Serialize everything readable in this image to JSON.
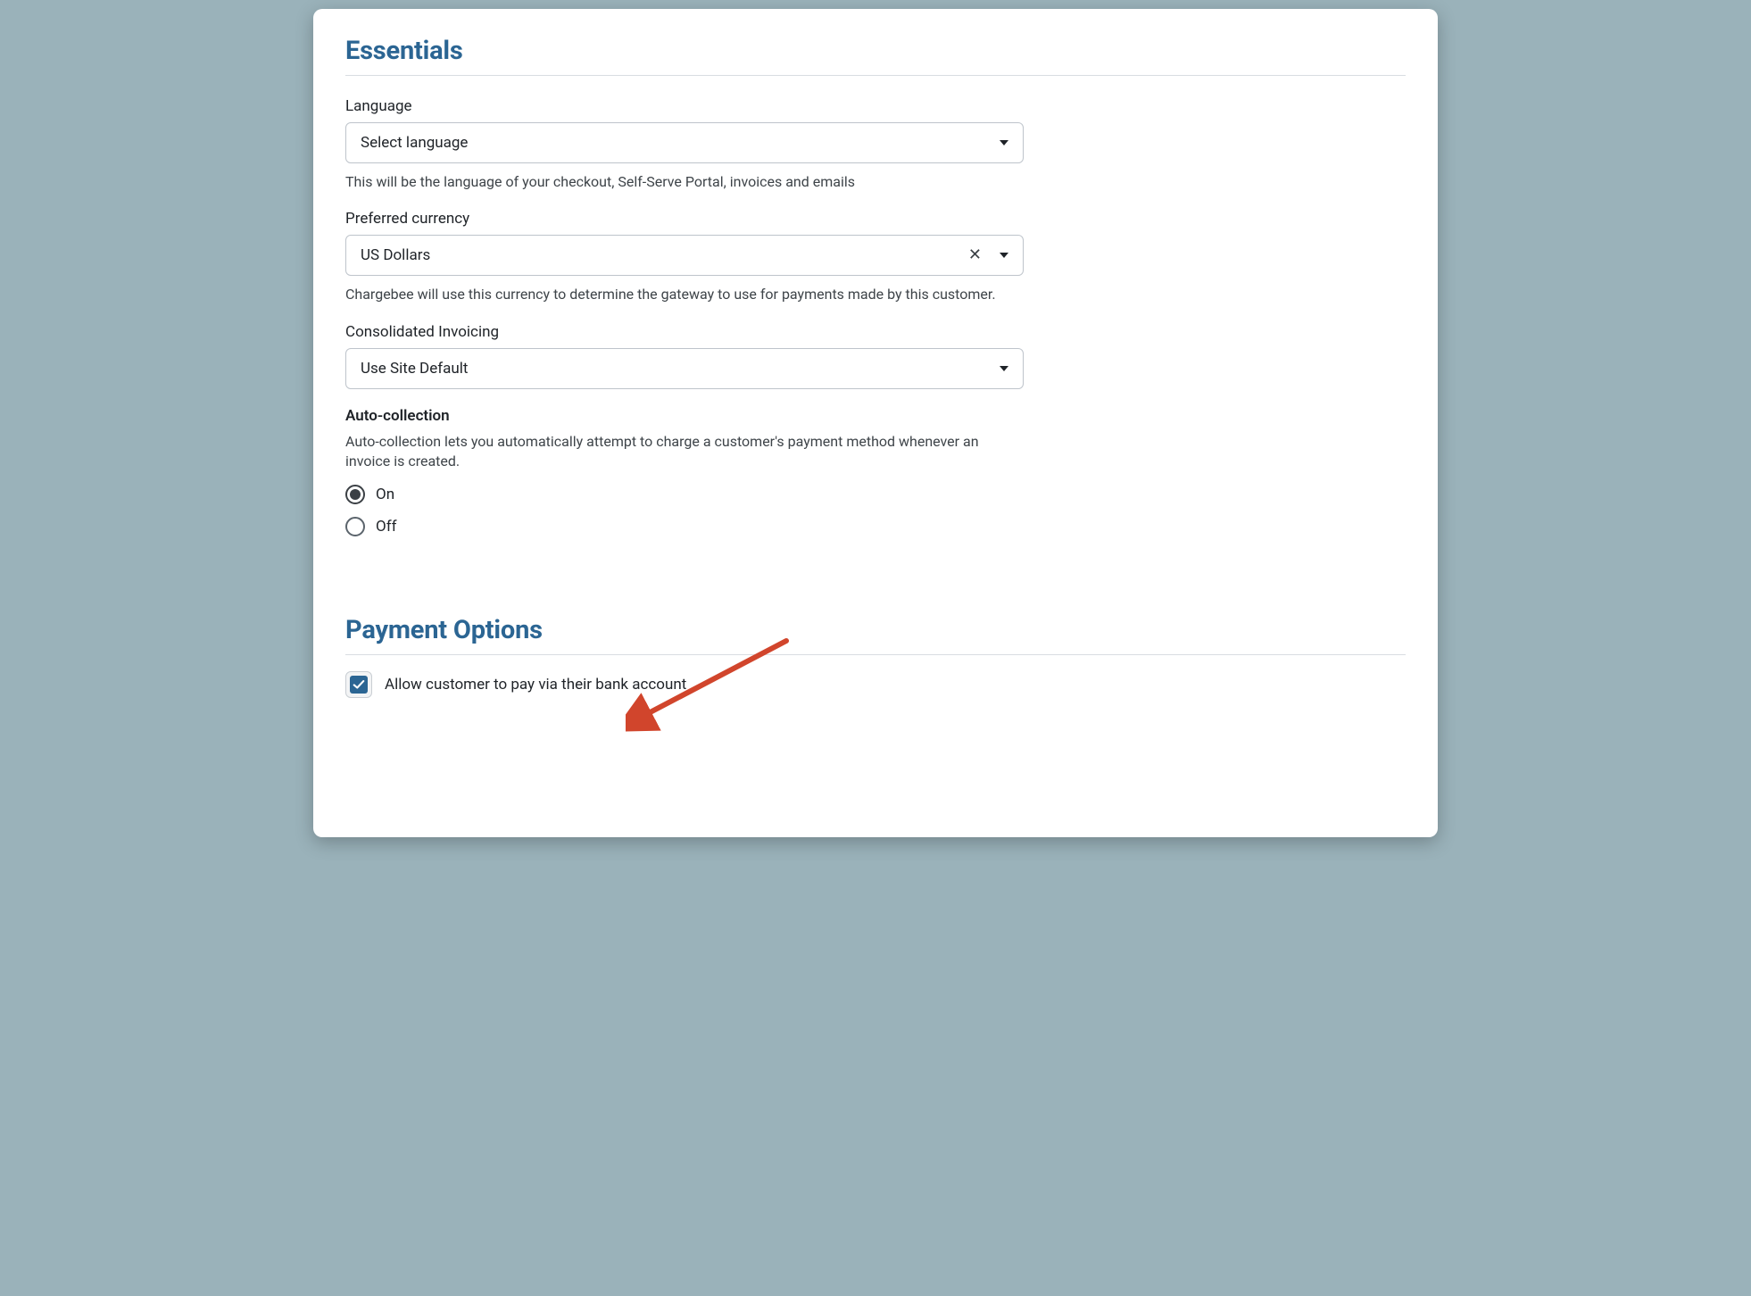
{
  "sections": {
    "essentials": {
      "title": "Essentials",
      "language": {
        "label": "Language",
        "value": "Select language",
        "help": "This will be the language of your checkout, Self-Serve Portal, invoices and emails"
      },
      "currency": {
        "label": "Preferred currency",
        "value": "US Dollars",
        "help": "Chargebee will use this currency to determine the gateway to use for payments made by this customer."
      },
      "consolidated": {
        "label": "Consolidated Invoicing",
        "value": "Use Site Default"
      },
      "auto_collection": {
        "label": "Auto-collection",
        "help": "Auto-collection lets you automatically attempt to charge a customer's payment method whenever an invoice is created.",
        "options": {
          "on": "On",
          "off": "Off"
        },
        "selected": "on"
      }
    },
    "payment_options": {
      "title": "Payment Options",
      "bank_checkbox": {
        "label": "Allow customer to pay via their bank account",
        "checked": true
      }
    }
  }
}
